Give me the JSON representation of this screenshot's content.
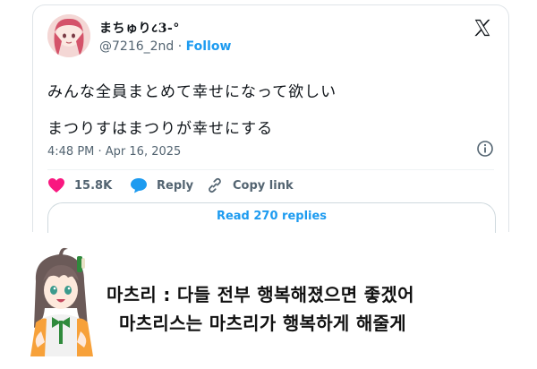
{
  "tweet": {
    "author_name": "まちゅり८3-°",
    "handle": "@7216_2nd",
    "separator": "·",
    "follow_label": "Follow",
    "text_line1": "みんな全員まとめて幸せになって欲しい",
    "text_line2": "まつりすはまつりが幸せにする",
    "timestamp": "4:48 PM · Apr 16, 2025",
    "likes": "15.8K",
    "reply_label": "Reply",
    "copy_link_label": "Copy link",
    "read_replies_label": "Read 270 replies"
  },
  "colors": {
    "accent": "#1d9bf0",
    "like_heart": "#f91880",
    "text": "#0f1419",
    "muted": "#536471"
  },
  "icons": [
    "avatar-image",
    "x-logo-icon",
    "info-icon",
    "heart-icon",
    "reply-bubble-icon",
    "link-icon",
    "character-illustration"
  ],
  "caption": {
    "line1": "마츠리 : 다들 전부 행복해졌으면 좋겠어",
    "line2": "마츠리스는 마츠리가 행복하게 해줄게"
  }
}
